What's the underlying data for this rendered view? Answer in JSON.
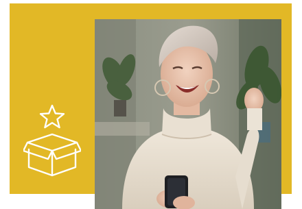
{
  "colors": {
    "accent": "#e2b826",
    "icon_stroke": "#ffffff",
    "sweater": "#e8dfd0",
    "hair": "#d9cfc6",
    "background_wall": "#7f8274"
  },
  "icons": {
    "box_star": "gift-box-with-star-icon"
  },
  "photo": {
    "subject": "smiling-woman-with-phone-celebrating"
  }
}
